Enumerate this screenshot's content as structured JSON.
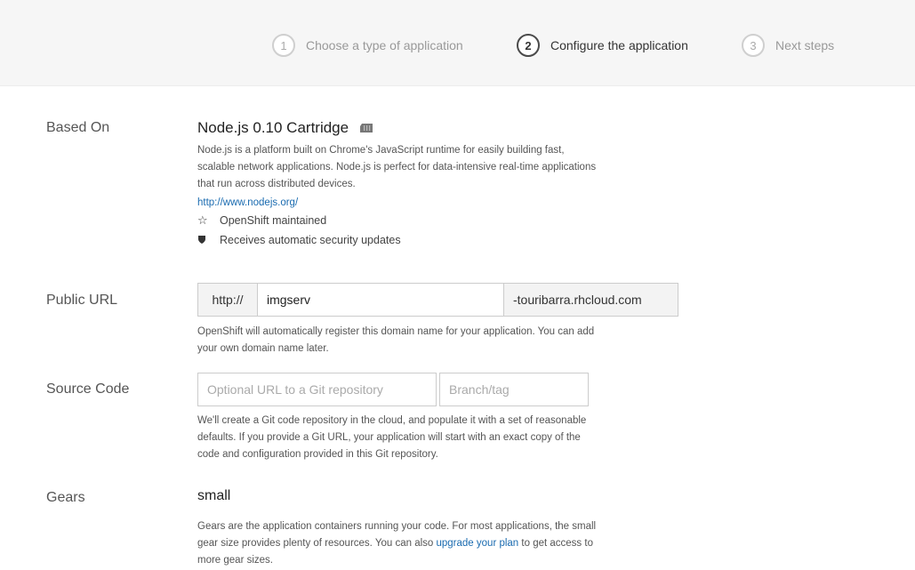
{
  "wizard": {
    "steps": [
      {
        "number": "1",
        "label": "Choose a type of application"
      },
      {
        "number": "2",
        "label": "Configure the application"
      },
      {
        "number": "3",
        "label": "Next steps"
      }
    ],
    "active_step": 2
  },
  "based_on": {
    "label": "Based On",
    "title": "Node.js 0.10 Cartridge",
    "icon": "cartridge-icon",
    "description_lines": [
      "Node.js is a platform built on Chrome's JavaScript runtime for easily building fast,",
      "scalable network applications. Node.js is perfect for data-intensive real-time applications",
      "that run across distributed devices."
    ],
    "link": "http://www.nodejs.org/",
    "features": [
      {
        "icon": "star-outline-icon",
        "text": "OpenShift maintained"
      },
      {
        "icon": "shield-icon",
        "text": "Receives automatic security updates"
      }
    ]
  },
  "public_url": {
    "label": "Public URL",
    "prefix": "http://",
    "value": "imgserv",
    "suffix": "-touribarra.rhcloud.com",
    "help_lines": [
      "OpenShift will automatically register this domain name for your application. You can add",
      "your own domain name later."
    ]
  },
  "source_code": {
    "label": "Source Code",
    "repo_placeholder": "Optional URL to a Git repository",
    "branch_placeholder": "Branch/tag",
    "help_lines": [
      "We'll create a Git code repository in the cloud, and populate it with a set of reasonable",
      "defaults. If you provide a Git URL, your application will start with an exact copy of the",
      "code and configuration provided in this Git repository."
    ]
  },
  "gears": {
    "label": "Gears",
    "value": "small",
    "help_line1": "Gears are the application containers running your code. For most applications, the small",
    "help_line2_before": "gear size provides plenty of resources. You can also ",
    "help_link": "upgrade your plan",
    "help_line2_after": " to get access to",
    "help_line3": "more gear sizes."
  },
  "colors": {
    "link": "#1a6bb0",
    "wizard_bg": "#f6f6f6",
    "active_step": "#333333",
    "inactive_step": "#999999"
  }
}
